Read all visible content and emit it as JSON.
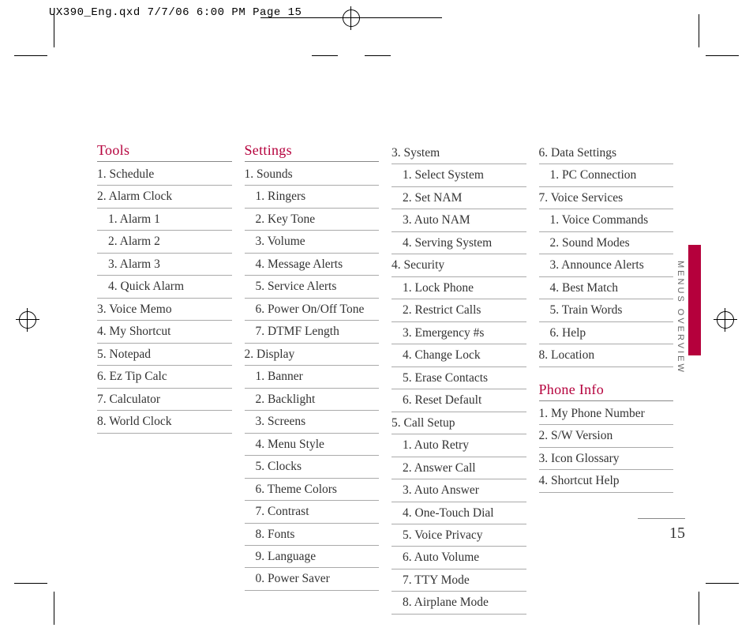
{
  "print_header": "UX390_Eng.qxd  7/7/06  6:00 PM  Page 15",
  "side_label": "MENUS OVERVIEW",
  "page_number": "15",
  "col1": {
    "heading": "Tools",
    "items": [
      "1. Schedule",
      "2. Alarm Clock",
      "1. Alarm 1",
      "2. Alarm 2",
      "3. Alarm 3",
      "4. Quick Alarm",
      "3. Voice Memo",
      "4. My Shortcut",
      "5. Notepad",
      "6. Ez Tip Calc",
      "7. Calculator",
      "8. World Clock"
    ],
    "sub_flags": [
      0,
      0,
      1,
      1,
      1,
      1,
      0,
      0,
      0,
      0,
      0,
      0
    ]
  },
  "col2": {
    "heading": "Settings",
    "items": [
      "1. Sounds",
      "1. Ringers",
      "2. Key Tone",
      "3. Volume",
      "4. Message Alerts",
      "5. Service Alerts",
      "6. Power On/Off Tone",
      "7. DTMF Length",
      "2. Display",
      "1. Banner",
      "2. Backlight",
      "3. Screens",
      "4. Menu Style",
      "5. Clocks",
      "6. Theme Colors",
      "7. Contrast",
      "8. Fonts",
      "9. Language",
      "0. Power Saver"
    ],
    "sub_flags": [
      0,
      1,
      1,
      1,
      1,
      1,
      1,
      1,
      0,
      1,
      1,
      1,
      1,
      1,
      1,
      1,
      1,
      1,
      1
    ]
  },
  "col3": {
    "items": [
      "3. System",
      "1. Select System",
      "2. Set NAM",
      "3. Auto NAM",
      "4. Serving System",
      "4. Security",
      "1. Lock Phone",
      "2. Restrict Calls",
      "3. Emergency #s",
      "4. Change Lock",
      "5. Erase Contacts",
      "6. Reset Default",
      "5. Call Setup",
      "1. Auto Retry",
      "2. Answer Call",
      "3. Auto Answer",
      "4. One-Touch Dial",
      "5. Voice Privacy",
      "6. Auto Volume",
      "7. TTY Mode",
      "8. Airplane Mode"
    ],
    "sub_flags": [
      0,
      1,
      1,
      1,
      1,
      0,
      1,
      1,
      1,
      1,
      1,
      1,
      0,
      1,
      1,
      1,
      1,
      1,
      1,
      1,
      1
    ]
  },
  "col4a": {
    "items": [
      "6. Data Settings",
      "1. PC Connection",
      "7. Voice Services",
      "1. Voice Commands",
      "2. Sound Modes",
      "3. Announce Alerts",
      "4. Best Match",
      "5. Train Words",
      "6. Help",
      "8. Location"
    ],
    "sub_flags": [
      0,
      1,
      0,
      1,
      1,
      1,
      1,
      1,
      1,
      0
    ]
  },
  "col4b": {
    "heading": "Phone Info",
    "items": [
      "1. My Phone Number",
      "2. S/W Version",
      "3. Icon Glossary",
      "4. Shortcut Help"
    ],
    "sub_flags": [
      0,
      0,
      0,
      0
    ]
  }
}
